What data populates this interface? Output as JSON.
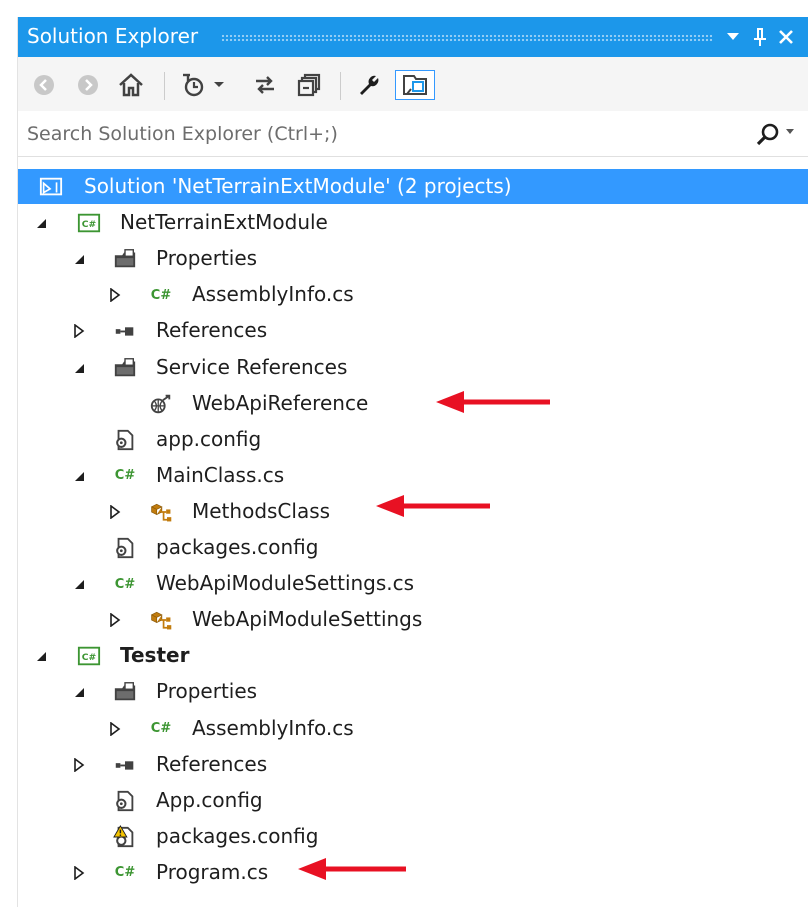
{
  "window": {
    "title": "Solution Explorer"
  },
  "search": {
    "placeholder": "Search Solution Explorer (Ctrl+;)"
  },
  "colors": {
    "titlebar": "#1c97ea",
    "selection": "#3399ff",
    "csharp_green": "#3c9532",
    "arrow_red": "#e81123",
    "class_orange": "#c27c0e"
  },
  "tree": [
    {
      "label": "Solution 'NetTerrainExtModule' (2 projects)",
      "icon": "solution-icon",
      "expander": "none",
      "selected": true
    },
    {
      "label": "NetTerrainExtModule",
      "icon": "csharp-project-icon",
      "expander": "expanded"
    },
    {
      "label": "Properties",
      "icon": "properties-folder-icon",
      "expander": "expanded"
    },
    {
      "label": "AssemblyInfo.cs",
      "icon": "csharp-file-icon",
      "expander": "collapsed"
    },
    {
      "label": "References",
      "icon": "references-icon",
      "expander": "collapsed"
    },
    {
      "label": "Service References",
      "icon": "service-folder-icon",
      "expander": "expanded"
    },
    {
      "label": "WebApiReference",
      "icon": "service-reference-icon",
      "expander": "none",
      "annotated": true
    },
    {
      "label": "app.config",
      "icon": "config-file-icon",
      "expander": "none"
    },
    {
      "label": "MainClass.cs",
      "icon": "csharp-file-icon",
      "expander": "expanded"
    },
    {
      "label": "MethodsClass",
      "icon": "class-icon",
      "expander": "collapsed",
      "annotated": true
    },
    {
      "label": "packages.config",
      "icon": "config-file-icon",
      "expander": "none"
    },
    {
      "label": "WebApiModuleSettings.cs",
      "icon": "csharp-file-icon",
      "expander": "expanded"
    },
    {
      "label": "WebApiModuleSettings",
      "icon": "class-icon",
      "expander": "collapsed"
    },
    {
      "label": "Tester",
      "icon": "csharp-project-icon",
      "expander": "expanded",
      "bold": true
    },
    {
      "label": "Properties",
      "icon": "properties-folder-icon",
      "expander": "expanded"
    },
    {
      "label": "AssemblyInfo.cs",
      "icon": "csharp-file-icon",
      "expander": "collapsed"
    },
    {
      "label": "References",
      "icon": "references-icon",
      "expander": "collapsed"
    },
    {
      "label": "App.config",
      "icon": "config-file-icon",
      "expander": "none"
    },
    {
      "label": "packages.config",
      "icon": "config-warning-icon",
      "expander": "none"
    },
    {
      "label": "Program.cs",
      "icon": "csharp-file-icon",
      "expander": "collapsed",
      "annotated": true
    }
  ],
  "icons": {
    "csharp": "C#"
  }
}
